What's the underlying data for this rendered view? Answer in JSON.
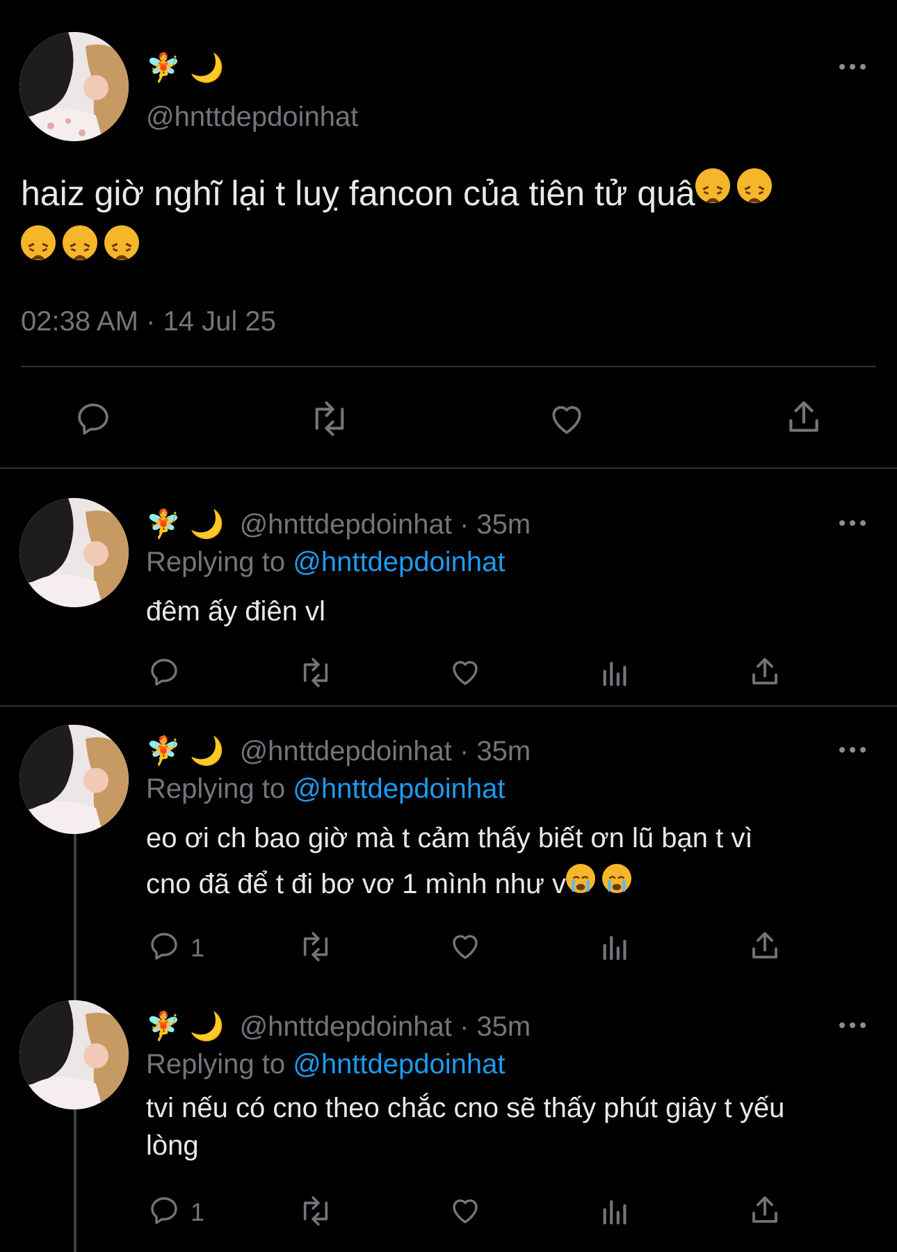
{
  "main_tweet": {
    "display_name_emoji": "🧚 🌙",
    "handle": "@hnttdepdoinhat",
    "text": "haiz giờ nghĩ lại t luỵ fancon của tiên tử quâ",
    "emoji_name": "weary-face",
    "timestamp": "02:38 AM · 14 Jul 25"
  },
  "replies": [
    {
      "display_name_emoji": "🧚 🌙",
      "handle_time": "@hnttdepdoinhat · 35m",
      "replying_prefix": "Replying to ",
      "replying_handle": "@hnttdepdoinhat",
      "text_line1": "đêm ấy điên vl",
      "text_line2": "",
      "reply_count": ""
    },
    {
      "display_name_emoji": "🧚 🌙",
      "handle_time": "@hnttdepdoinhat · 35m",
      "replying_prefix": "Replying to ",
      "replying_handle": "@hnttdepdoinhat",
      "text_line1": "eo ơi ch bao giờ mà t cảm thấy biết ơn lũ bạn t vì",
      "text_line2": "cno đã để t đi bơ vơ 1 mình như v",
      "reply_count": "1"
    },
    {
      "display_name_emoji": "🧚 🌙",
      "handle_time": "@hnttdepdoinhat · 35m",
      "replying_prefix": "Replying to ",
      "replying_handle": "@hnttdepdoinhat",
      "text_line1": "tvi nếu có cno theo chắc cno sẽ thấy phút giây t yếu",
      "text_line2": "lòng",
      "reply_count": "1"
    }
  ],
  "colors": {
    "background": "#000000",
    "text": "#e7e9ea",
    "secondary": "#71767b",
    "mention": "#1d9bf0",
    "divider": "#2f3336",
    "emoji_yellow": "#f5b62a"
  }
}
